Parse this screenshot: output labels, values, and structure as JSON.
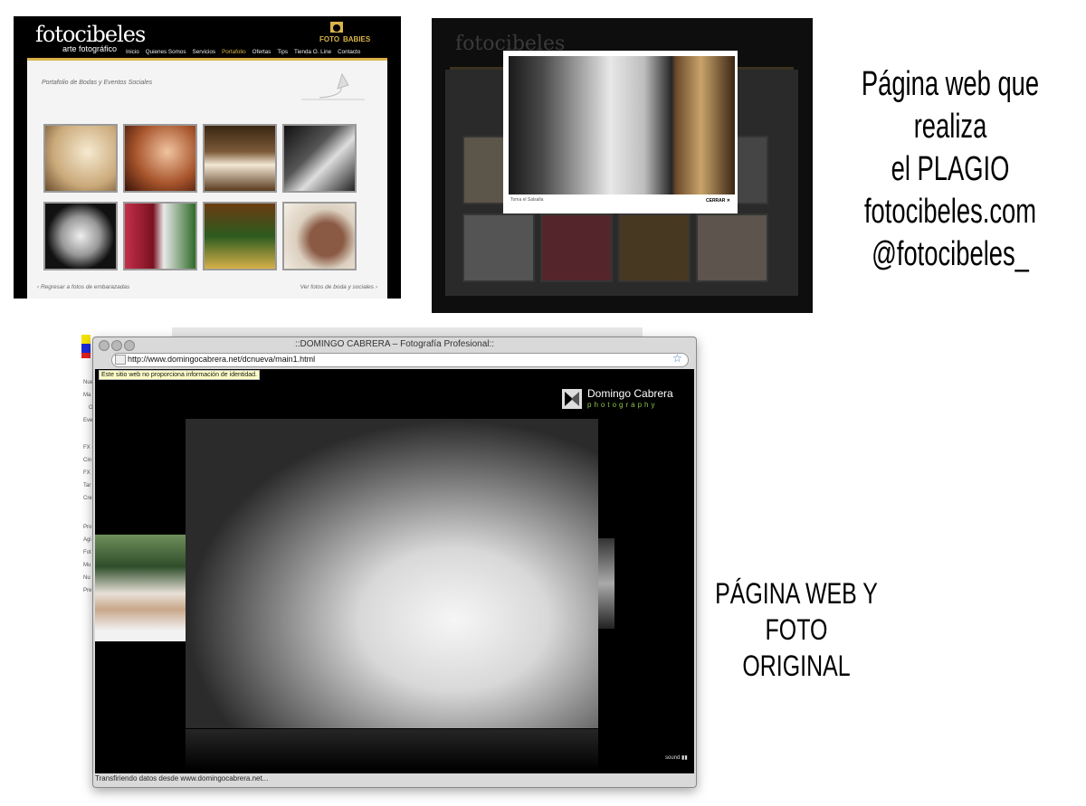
{
  "shot1": {
    "logo": "fotocibeles",
    "logo_sub": "arte fotográfico",
    "nav": [
      "Inicio",
      "Quienes Somos",
      "Servicios",
      "Portafolio",
      "Ofertas",
      "Tips",
      "Tienda O. Line",
      "Contacto"
    ],
    "portfolio_title": "Portafolio de Bodas y Eventos Sociales",
    "footer_left": "‹ Regresar a fotos de embarazadas",
    "footer_right": "Ver fotos de boda y sociales ›"
  },
  "shot2": {
    "logo": "fotocibeles",
    "caption": "Toma el Salsalla",
    "close": "CERRAR ✕"
  },
  "note1": [
    "Página web que realiza",
    "el PLAGIO",
    "fotocibeles.com",
    "@fotocibeles_"
  ],
  "note2": [
    "PÁGINA WEB Y",
    "FOTO ORIGINAL"
  ],
  "browser": {
    "title": "::DOMINGO CABRERA – Fotografía Profesional::",
    "url": "http://www.domingocabrera.net/dcnueva/main1.html",
    "tooltip": "Este sitio web no proporciona información de identidad.",
    "brand": "Domingo Cabrera",
    "brand_sub": "photography",
    "sound": "sound",
    "status": "Transfiriendo datos desde www.domingocabrera.net..."
  },
  "left_panel": [
    "Nue",
    "Ma",
    "O",
    "Eve",
    "FX -",
    "Cin",
    "FX",
    "Tar",
    "Cre",
    "Pro",
    "Agi",
    "Fot",
    "Mu",
    "Nu",
    "Pre"
  ],
  "colors": {
    "gold": "#d9b44a",
    "tooltip": "#ffffc8",
    "brand_green": "#8bc34a"
  }
}
